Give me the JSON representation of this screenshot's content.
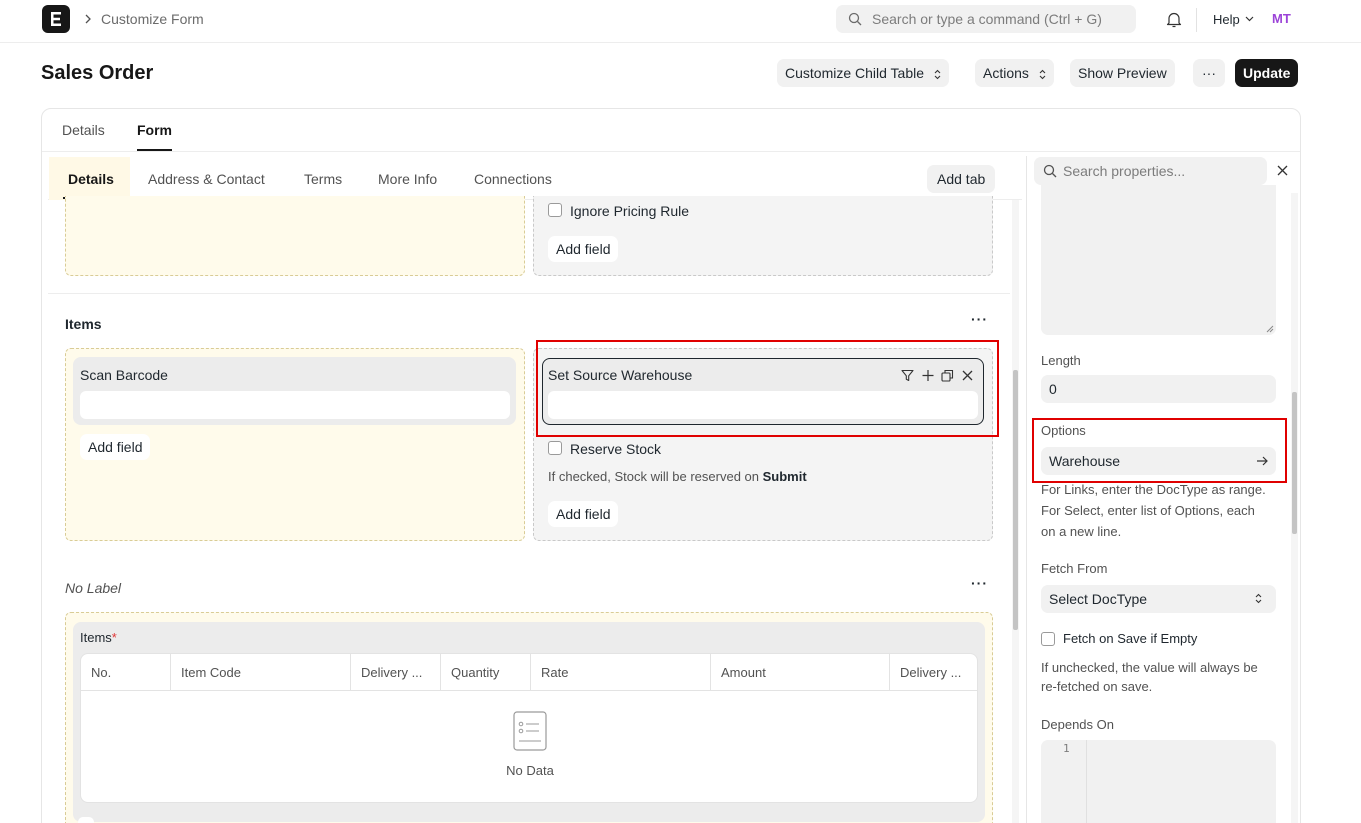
{
  "navbar": {
    "breadcrumb": "Customize Form",
    "search_placeholder": "Search or type a command (Ctrl + G)",
    "help_label": "Help",
    "avatar_initials": "MT",
    "logo_letter": "E"
  },
  "header": {
    "title": "Sales Order",
    "customize_child_table": "Customize Child Table",
    "actions": "Actions",
    "show_preview": "Show Preview",
    "more": "···",
    "update": "Update"
  },
  "top_tabs": [
    "Details",
    "Form"
  ],
  "form_tabs": [
    "Details",
    "Address & Contact",
    "Terms",
    "More Info",
    "Connections"
  ],
  "add_tab_label": "Add tab",
  "top_section": {
    "ignore_pricing_rule": "Ignore Pricing Rule",
    "add_field": "Add field"
  },
  "items_section": {
    "title": "Items",
    "scan_barcode": "Scan Barcode",
    "add_field_left": "Add field",
    "set_source_warehouse": "Set Source Warehouse",
    "reserve_stock": "Reserve Stock",
    "reserve_help_prefix": "If checked, Stock will be reserved on",
    "reserve_help_bold": "Submit",
    "add_field_right": "Add field"
  },
  "no_label_section": {
    "title": "No Label",
    "table_label": "Items",
    "required_mark": "*",
    "columns": [
      "No.",
      "Item Code",
      "Delivery ...",
      "Quantity",
      "Rate",
      "Amount",
      "Delivery ..."
    ],
    "empty_text": "No Data"
  },
  "sidebar": {
    "search_placeholder": "Search properties...",
    "length_label": "Length",
    "length_value": "0",
    "options_label": "Options",
    "options_value": "Warehouse",
    "options_help": [
      "For Links, enter the DocType as range.",
      "For Select, enter list of Options, each",
      "on a new line."
    ],
    "fetch_from_label": "Fetch From",
    "fetch_from_value": "Select DocType",
    "fetch_on_save": "Fetch on Save if Empty",
    "fetch_help": [
      "If unchecked, the value will always be",
      "re-fetched on save."
    ],
    "depends_on_label": "Depends On",
    "line_number": "1"
  },
  "colors": {
    "highlight": "#e00000",
    "primary": "#171717",
    "section_yellow": "#fffbeb"
  }
}
